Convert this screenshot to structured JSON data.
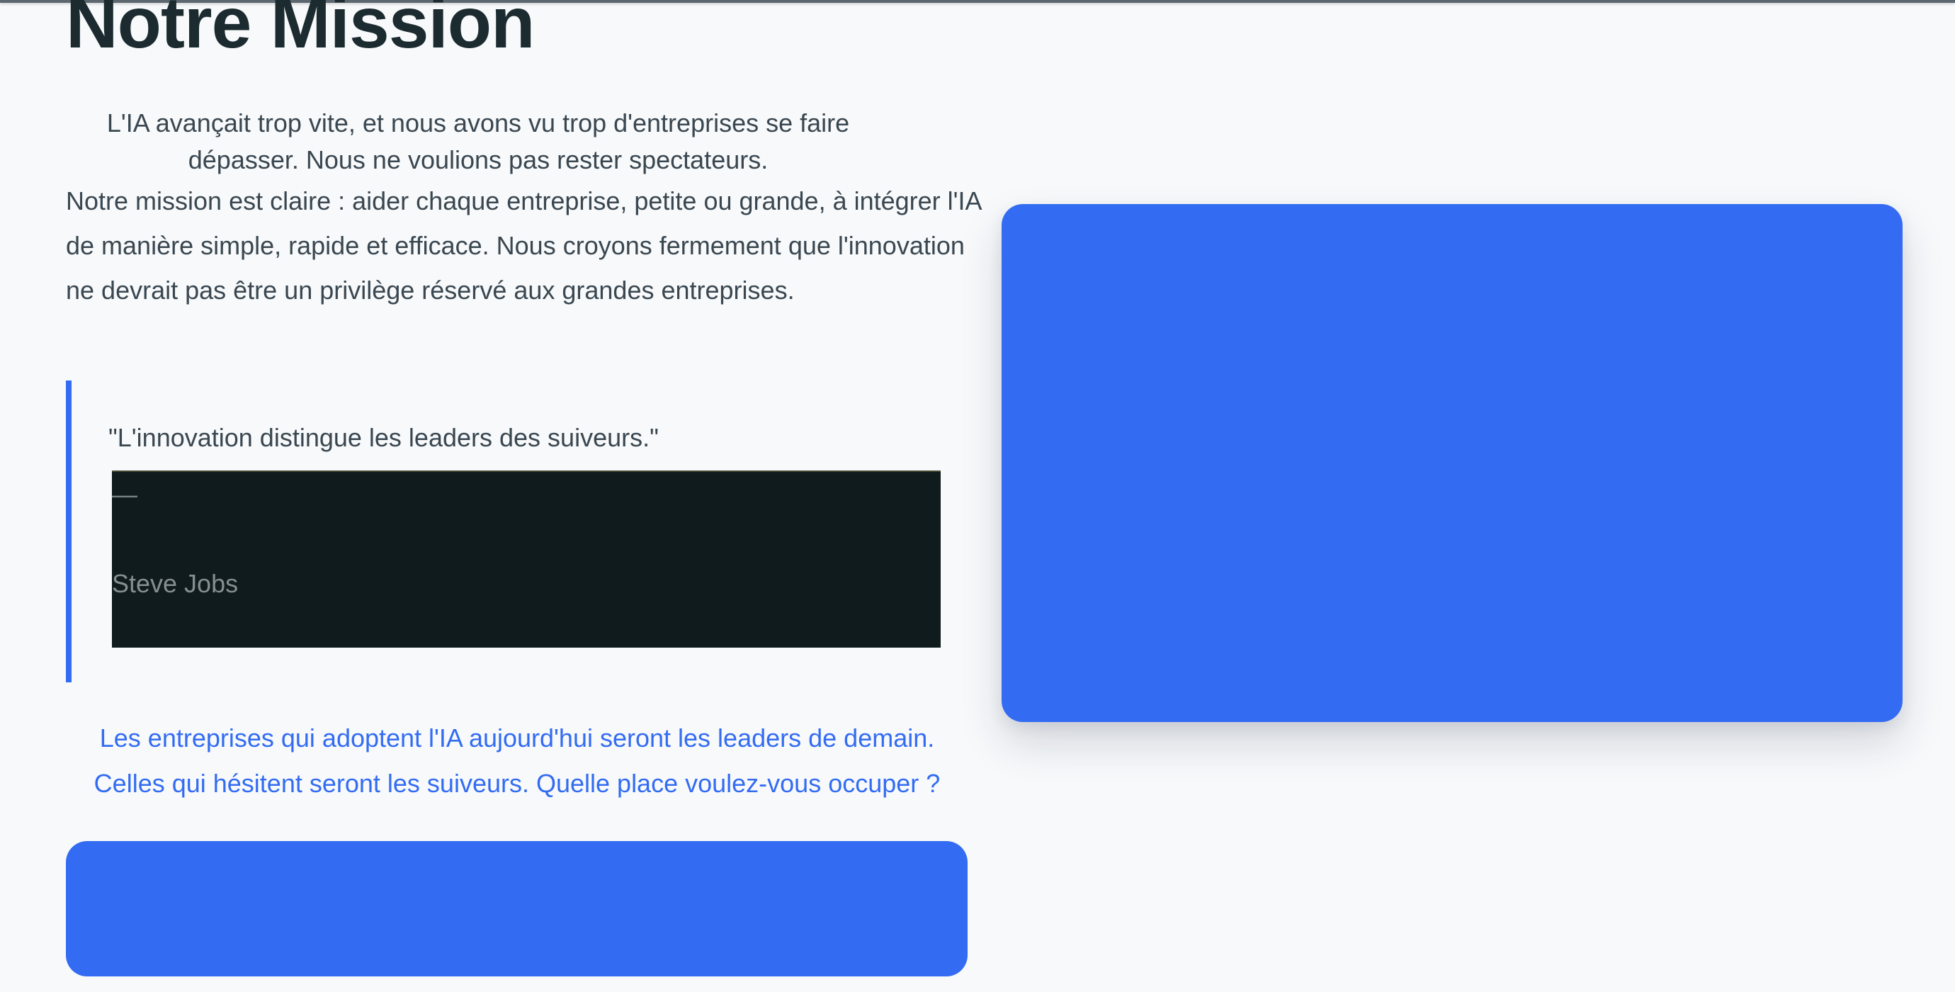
{
  "mission": {
    "title": "Notre Mission",
    "intro": "L'IA avançait trop vite, et nous avons vu trop d'entreprises se faire dépasser. Nous ne voulions pas rester spectateurs.",
    "body": "Notre mission est claire : aider chaque entreprise, petite ou grande, à intégrer l'IA de manière simple, rapide et efficace. Nous croyons fermement que l'innovation ne devrait pas être un privilège réservé aux grandes entreprises.",
    "quote": {
      "text": "\"L'innovation distingue les leaders des suiveurs.\"",
      "dash": "—",
      "author": "Steve Jobs"
    },
    "cta_text": "Les entreprises qui adoptent l'IA aujourd'hui seront les leaders de demain. Celles qui hésitent seront les suiveurs. Quelle place voulez-vous occuper ?",
    "cta_button_label": ""
  },
  "colors": {
    "accent": "#336cf2",
    "heading": "#1b2b30",
    "text": "#3a4750",
    "background": "#f7f9fb",
    "quote_footer_bg": "#101b1d"
  }
}
